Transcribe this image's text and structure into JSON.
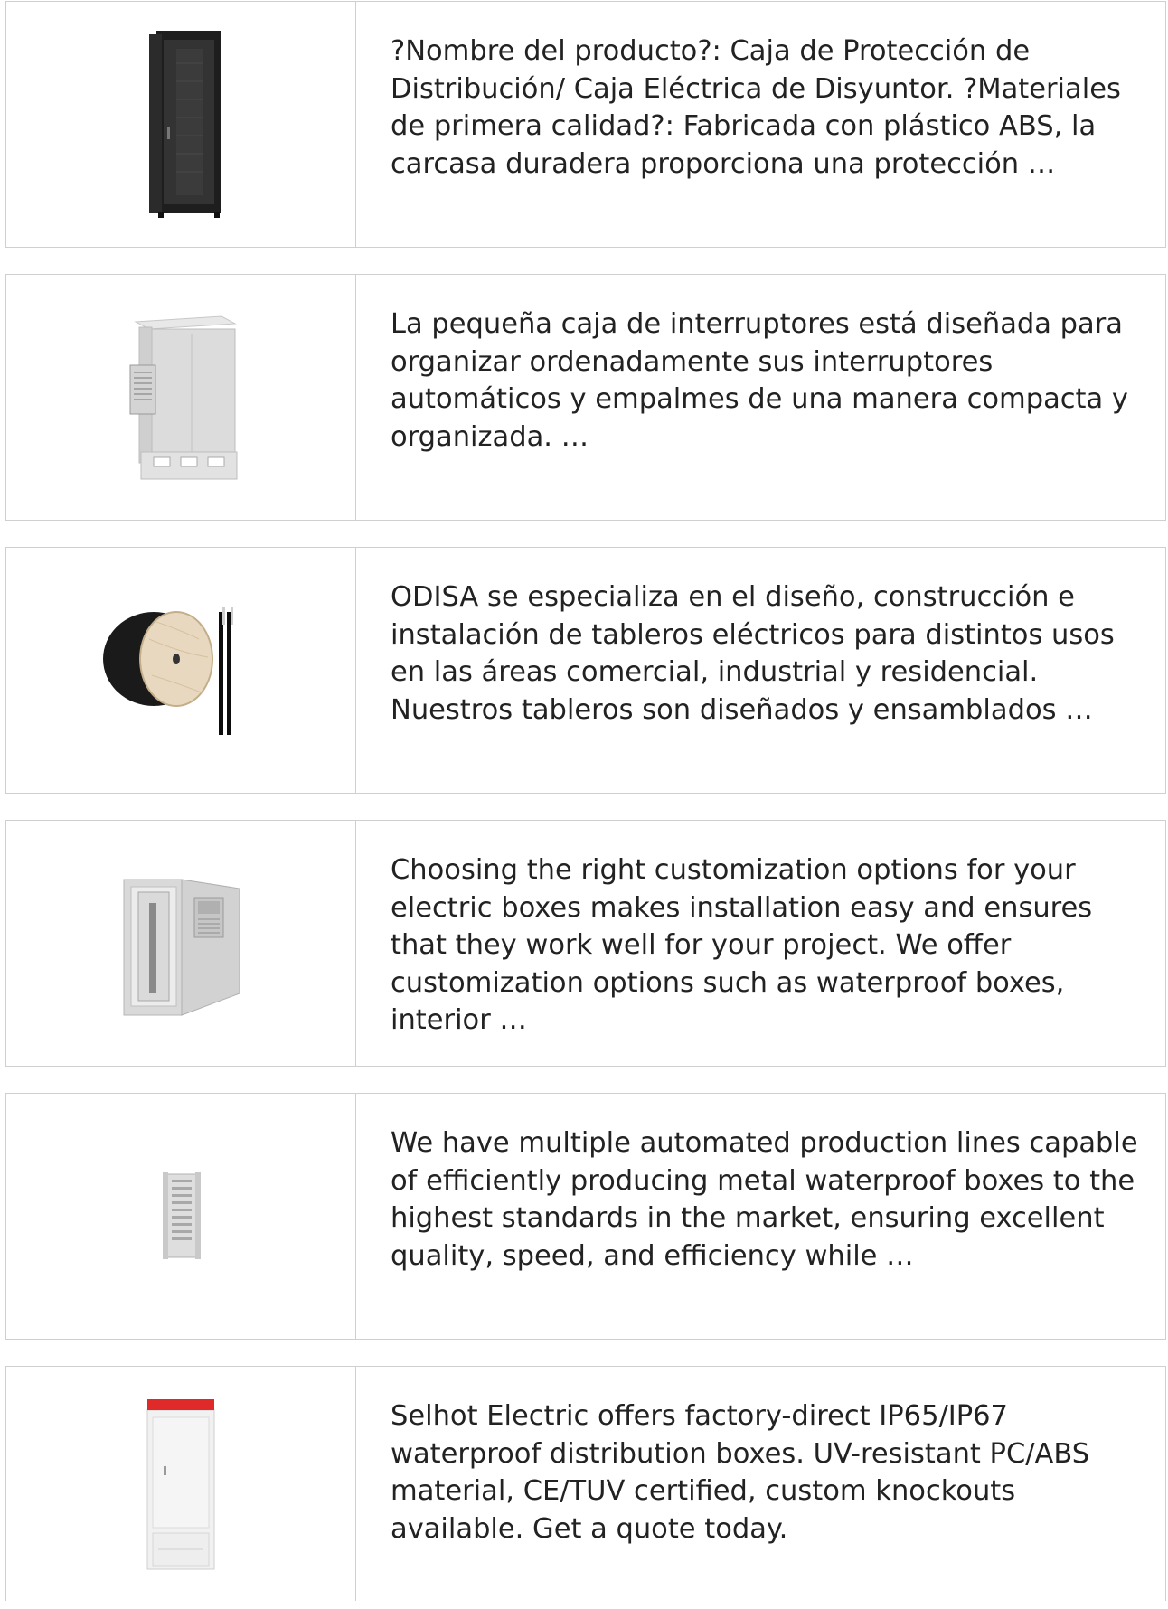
{
  "items": [
    {
      "image": "black-server-rack-cabinet",
      "text": "?Nombre del producto?: Caja de Protección de Distribución/ Caja Eléctrica de Disyuntor. ?Materiales de primera calidad?: Fabricada con plástico ABS, la carcasa duradera proporciona una protección …"
    },
    {
      "image": "outdoor-telecom-cabinet-with-air-conditioner",
      "text": "La pequeña caja de interruptores está diseñada para organizar ordenadamente sus interruptores automáticos y empalmes de una manera compacta y organizada. …"
    },
    {
      "image": "cable-reel-drum",
      "text": "ODISA se especializa en el diseño, construcción e instalación de tableros eléctricos para distintos usos en las áreas comercial, industrial y residencial. Nuestros tableros son diseñados y ensamblados …"
    },
    {
      "image": "open-outdoor-cabinet",
      "text": "Choosing the right customization options for your electric boxes makes installation easy and ensures that they work well for your project. We offer customization options such as waterproof boxes, interior …"
    },
    {
      "image": "fiber-distribution-frame",
      "text": "We have multiple automated production lines capable of efficiently producing metal waterproof boxes to the highest standards in the market, ensuring excellent quality, speed, and efficiency while …"
    },
    {
      "image": "distribution-cabinet-red-top",
      "text": "Selhot Electric offers factory-direct IP65/IP67 waterproof distribution boxes. UV-resistant PC/ABS material, CE/TUV certified, custom knockouts available. Get a quote today."
    }
  ]
}
